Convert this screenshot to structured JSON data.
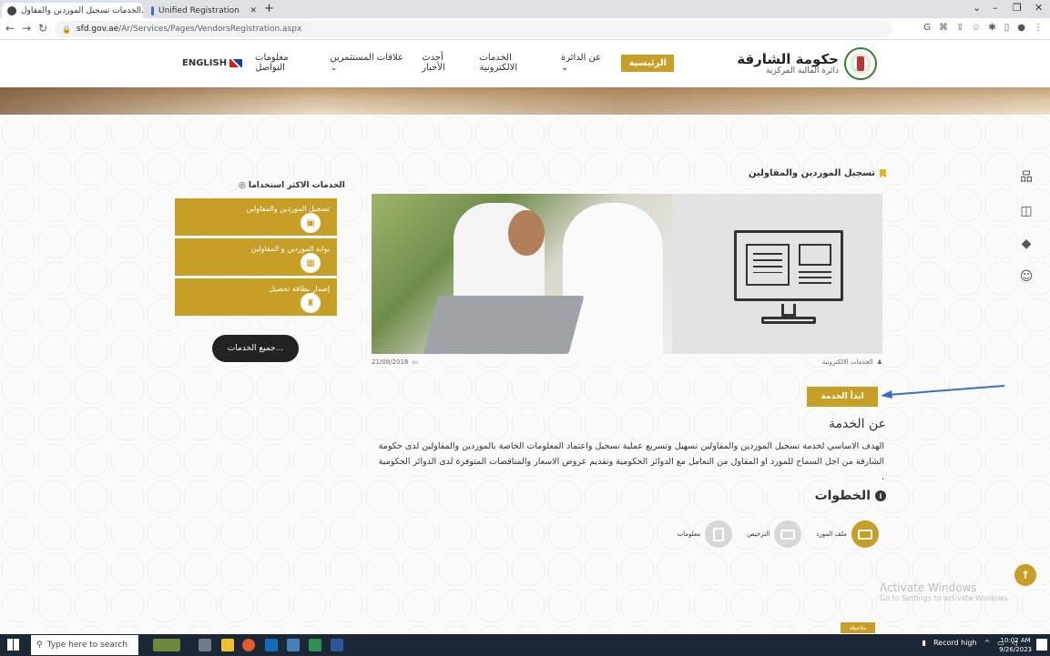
{
  "browser": {
    "tabs": [
      {
        "label": "الخدمات تسجيل الموردين والمقاول..."
      },
      {
        "label": "Unified Registration"
      }
    ],
    "url_host": "sfd.gov.ae",
    "url_path": "/Ar/Services/Pages/VendorsRegistration.aspx"
  },
  "site": {
    "logo_title": "حكومة الشارقة",
    "logo_subtitle": "دائرة المالية المركزية",
    "nav": [
      {
        "label": "الرئيسية"
      },
      {
        "label": "عن الدائرة"
      },
      {
        "label": "الخدمات الالكترونية"
      },
      {
        "label": "أحدث الأخبار"
      },
      {
        "label": "علاقات المستثمرين"
      },
      {
        "label": "معلومات التواصل"
      },
      {
        "label": "ENGLISH"
      }
    ]
  },
  "service": {
    "title": "تسجيل الموردين والمقاولين",
    "date": "21/08/2018",
    "category": "الخدمات الالكترونية",
    "start_button": "ابدأ الخدمة",
    "about_title": "عن الخدمة",
    "about_text": "الهدف الاساسي لخدمة تسجيل الموردين والمقاولين تسهيل وتسريع عملية تسجيل واعتماد المعلومات الخاصة بالموردين والمقاولين لدى حكومة الشارقة من اجل السماح للمورد او المقاول من التعامل مع الدوائر الحكومية وتقديم عروض الاسعار والمناقصات المتوفرة لدى الدوائر الحكومية .",
    "steps_title": "الخطوات",
    "steps": [
      {
        "label": "ملف المورد"
      },
      {
        "label": "الترخيص"
      },
      {
        "label": "معلومات"
      }
    ]
  },
  "most_used": {
    "title": "الخدمات الاكثر استخداما",
    "items": [
      {
        "label": "تسجيل الموردين والمقاولين"
      },
      {
        "label": "بوابة الموردين و المقاولين"
      },
      {
        "label": "إصدار بطاقة تحصيل"
      }
    ],
    "all_services": "جميع الخدمات..."
  },
  "overlay": {
    "watermark_title": "Activate Windows",
    "watermark_sub": "Go to Settings to activate Windows.",
    "bottom_badge": "ملاحظة"
  },
  "taskbar": {
    "search_placeholder": "Type here to search",
    "tray_label": "Record high",
    "time": "10:02 AM",
    "date": "9/26/2023"
  },
  "colors": {
    "accent_gold": "#c79f27",
    "arrow_blue": "#3a6fc4"
  }
}
